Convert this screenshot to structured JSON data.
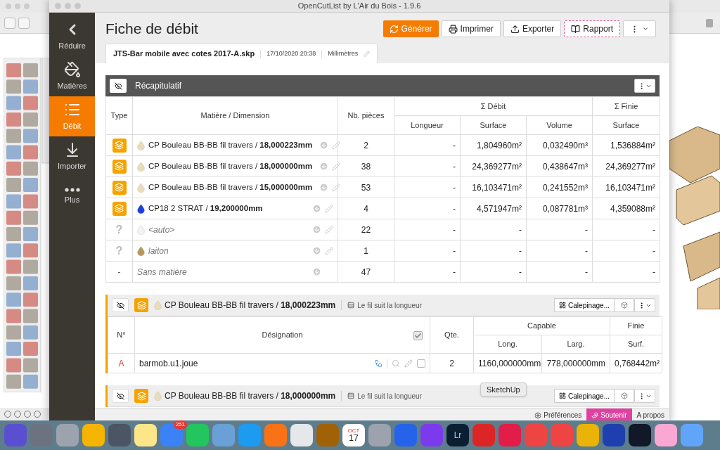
{
  "window": {
    "title": "OpenCutList by L'Air du Bois - 1.9.6"
  },
  "sidebar": {
    "items": [
      {
        "label": "Réduire",
        "kind": "collapse",
        "selected": false
      },
      {
        "label": "Matières",
        "kind": "materials",
        "selected": false
      },
      {
        "label": "Débit",
        "kind": "cutlist",
        "selected": true
      },
      {
        "label": "Importer",
        "kind": "import",
        "selected": false
      },
      {
        "label": "Plus",
        "kind": "more",
        "selected": false
      }
    ]
  },
  "page": {
    "title": "Fiche de débit"
  },
  "toolbar": [
    {
      "label": "Générer",
      "kind": "generate"
    },
    {
      "label": "Imprimer",
      "kind": "print"
    },
    {
      "label": "Exporter",
      "kind": "export"
    },
    {
      "label": "Rapport",
      "kind": "report"
    },
    {
      "kind": "menu"
    }
  ],
  "document": {
    "filename": "JTS-Bar mobile avec cotes 2017-A.skp",
    "date": "17/10/2020 20:38",
    "unit": "Millimètres"
  },
  "summary": {
    "title": "Récapitulatif",
    "columns": {
      "type": "Type",
      "material": "Matière / Dimension",
      "count": "Nb. pièces",
      "cut": "Σ Débit",
      "finished": "Σ Finie",
      "length": "Longueur",
      "surface": "Surface",
      "volume": "Volume",
      "finished_surface": "Surface"
    },
    "rows": [
      {
        "kind": "material",
        "type_text": "",
        "name": "CP Bouleau BB-BB fil travers / **18,000223mm**",
        "color": "#e9dcbc",
        "editable": true,
        "count": "2",
        "length": "-",
        "surface": "1,804960m²",
        "volume": "0,032490m³",
        "finished": "1,536884m²"
      },
      {
        "kind": "material",
        "type_text": "",
        "name": "CP Bouleau BB-BB fil travers / **18,000000mm**",
        "color": "#e9dcbc",
        "editable": true,
        "count": "38",
        "length": "-",
        "surface": "24,369277m²",
        "volume": "0,438647m³",
        "finished": "24,369277m²"
      },
      {
        "kind": "material",
        "type_text": "",
        "name": "CP Bouleau BB-BB fil travers / **15,000000mm**",
        "color": "#e9dcbc",
        "editable": true,
        "count": "53",
        "length": "-",
        "surface": "16,103471m²",
        "volume": "0,241552m³",
        "finished": "16,103471m²"
      },
      {
        "kind": "material",
        "type_text": "",
        "name": "CP18 2 STRAT / **19,200000mm**",
        "color": "#1a3fe0",
        "editable": true,
        "count": "4",
        "length": "-",
        "surface": "4,571947m²",
        "volume": "0,087781m³",
        "finished": "4,359088m²"
      },
      {
        "kind": "unknown",
        "type_text": "?",
        "name": "<auto>",
        "color": "#f3f3f3",
        "editable": true,
        "count": "22",
        "length": "-",
        "surface": "-",
        "volume": "-",
        "finished": "-"
      },
      {
        "kind": "unknown",
        "type_text": "?",
        "name": "laiton",
        "color": "#b8975a",
        "editable": true,
        "count": "1",
        "length": "-",
        "surface": "-",
        "volume": "-",
        "finished": "-"
      },
      {
        "kind": "none",
        "type_text": "-",
        "name": "Sans matière",
        "editable": false,
        "count": "47",
        "length": "-",
        "surface": "-",
        "volume": "-",
        "finished": "-"
      }
    ]
  },
  "groups": [
    {
      "name": "CP Bouleau BB-BB fil travers / **18,000223mm**",
      "color": "#e9dcbc",
      "grain": "Le fil suit la longueur",
      "layout_button": "Calepinage...",
      "parts": {
        "columns": {
          "number": "N°",
          "name": "Désignation",
          "qty": "Qte.",
          "capable": "Capable",
          "finished": "Finie",
          "length": "Long.",
          "width": "Larg.",
          "surface": "Surf."
        },
        "all_checked": true,
        "rows": [
          {
            "number": "A",
            "name": "barmob.u1.joue",
            "qty": "2",
            "length": "1160,000000mm",
            "width": "778,000000mm",
            "surface": "0,768442m²",
            "checked": false
          }
        ]
      }
    },
    {
      "name": "CP Bouleau BB-BB fil travers / **18,000000mm**",
      "color": "#e9dcbc",
      "grain": "Le fil suit la longueur",
      "layout_button": "Calepinage..."
    }
  ],
  "status_bar": [
    {
      "label": "Préférences",
      "kind": "settings",
      "selected": false
    },
    {
      "label": "Soutenir",
      "kind": "support",
      "selected": true
    },
    {
      "label": "A propos",
      "kind": "about",
      "selected": false
    }
  ],
  "tooltip": "SketchUp",
  "dock": [
    {
      "color": "#5a4fd0"
    },
    {
      "color": "#6b7280"
    },
    {
      "color": "#9ca3af"
    },
    {
      "color": "#f5b400"
    },
    {
      "color": "#4b5563"
    },
    {
      "color": "#fde68a"
    },
    {
      "color": "#3b82f6",
      "badge": "251"
    },
    {
      "color": "#22c55e"
    },
    {
      "color": "#6aa0d8"
    },
    {
      "color": "#1d9bf0"
    },
    {
      "color": "#f97316"
    },
    {
      "color": "#e5e7eb"
    },
    {
      "color": "#a16207"
    },
    {
      "color": "#ffffff",
      "caption": "OCT",
      "label": "17"
    },
    {
      "color": "#9ca3af"
    },
    {
      "color": "#2563eb"
    },
    {
      "color": "#7c3aed"
    },
    {
      "color": "#0b1f33",
      "label": "Lr"
    },
    {
      "color": "#dc2626"
    },
    {
      "color": "#e11d48"
    },
    {
      "color": "#ef4444"
    },
    {
      "color": "#ef4444"
    },
    {
      "color": "#eab308"
    },
    {
      "color": "#1e40af"
    },
    {
      "color": "#111827"
    },
    {
      "color": "#f9a8d4"
    },
    {
      "color": "#60a5fa"
    }
  ]
}
